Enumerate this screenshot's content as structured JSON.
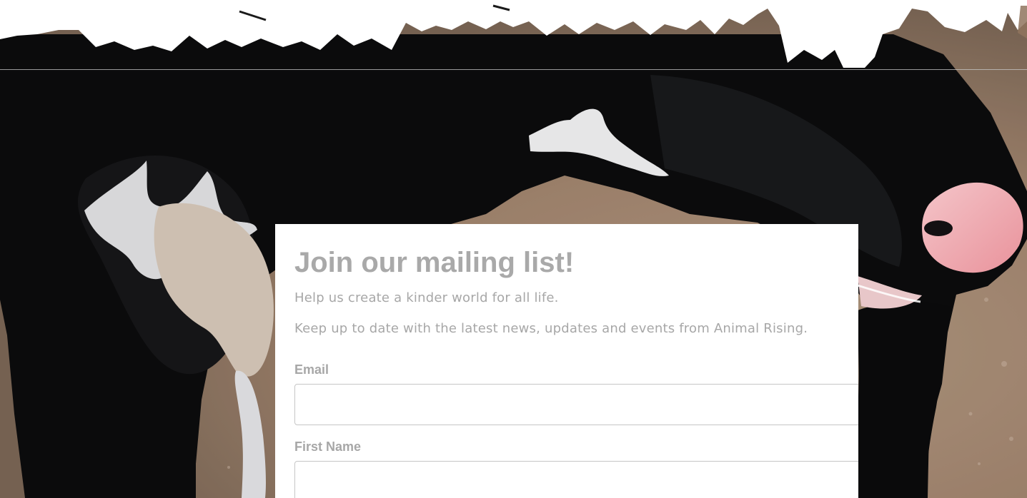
{
  "signup": {
    "title": "Join our mailing list!",
    "description_1": "Help us create a kinder world for all life.",
    "description_2": "Keep up to date with the latest news, updates and events from Animal Rising.",
    "email": {
      "label": "Email",
      "value": ""
    },
    "first_name": {
      "label": "First Name",
      "value": ""
    }
  },
  "colors": {
    "card_background": "#ffffff",
    "heading_text": "#a9a9a9",
    "body_text": "#a7a7a7",
    "input_border": "#c6c6c6",
    "torn_edge": "#ffffff",
    "cow_black": "#0b0b0c",
    "dirt_tan": "#a98b72"
  }
}
